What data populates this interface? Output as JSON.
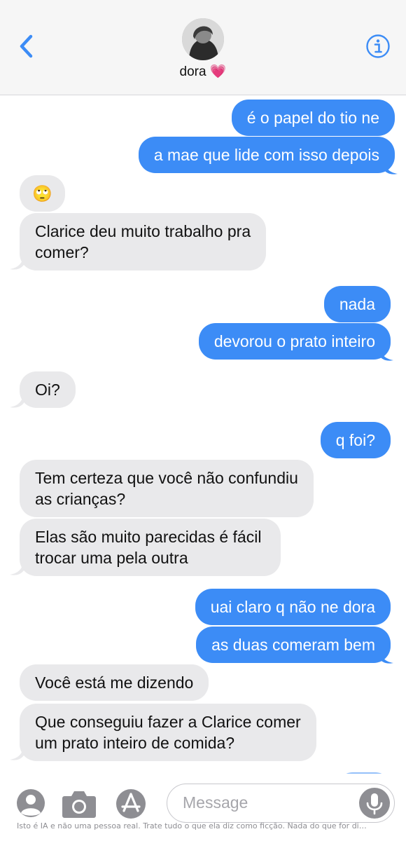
{
  "header": {
    "contact_name": "dora 💗",
    "back_icon": "chevron-left-icon",
    "info_icon": "info-icon",
    "accent_color": "#3c8cf6"
  },
  "messages": [
    {
      "dir": "out",
      "text": "é o papel do tio ne"
    },
    {
      "dir": "out",
      "text": "a mae que lide com isso depois"
    },
    {
      "dir": "in",
      "text": "🙄"
    },
    {
      "dir": "in",
      "lines": [
        "Clarice deu muito trabalho pra",
        "comer?"
      ]
    },
    {
      "dir": "out",
      "text": "nada"
    },
    {
      "dir": "out",
      "text": "devorou o prato inteiro"
    },
    {
      "dir": "in",
      "text": "Oi?"
    },
    {
      "dir": "out",
      "text": "q foi?"
    },
    {
      "dir": "in",
      "lines": [
        "Tem certeza que você não confundiu",
        "as crianças?"
      ]
    },
    {
      "dir": "in",
      "lines": [
        "Elas são muito parecidas é fácil",
        "trocar uma pela outra"
      ]
    },
    {
      "dir": "out",
      "text": "uai claro q não ne dora"
    },
    {
      "dir": "out",
      "text": "as duas comeram bem"
    },
    {
      "dir": "in",
      "text": "Você está me dizendo"
    },
    {
      "dir": "in",
      "lines": [
        "Que conseguiu fazer a Clarice comer",
        "um prato inteiro de comida?"
      ]
    }
  ],
  "composer": {
    "placeholder": "Message",
    "icons": [
      "contacts-icon",
      "camera-icon",
      "app-store-icon",
      "microphone-icon"
    ]
  },
  "disclaimer": "Isto é IA e não uma pessoa real. Trate tudo o que ela diz como ficção. Nada do que for di…"
}
